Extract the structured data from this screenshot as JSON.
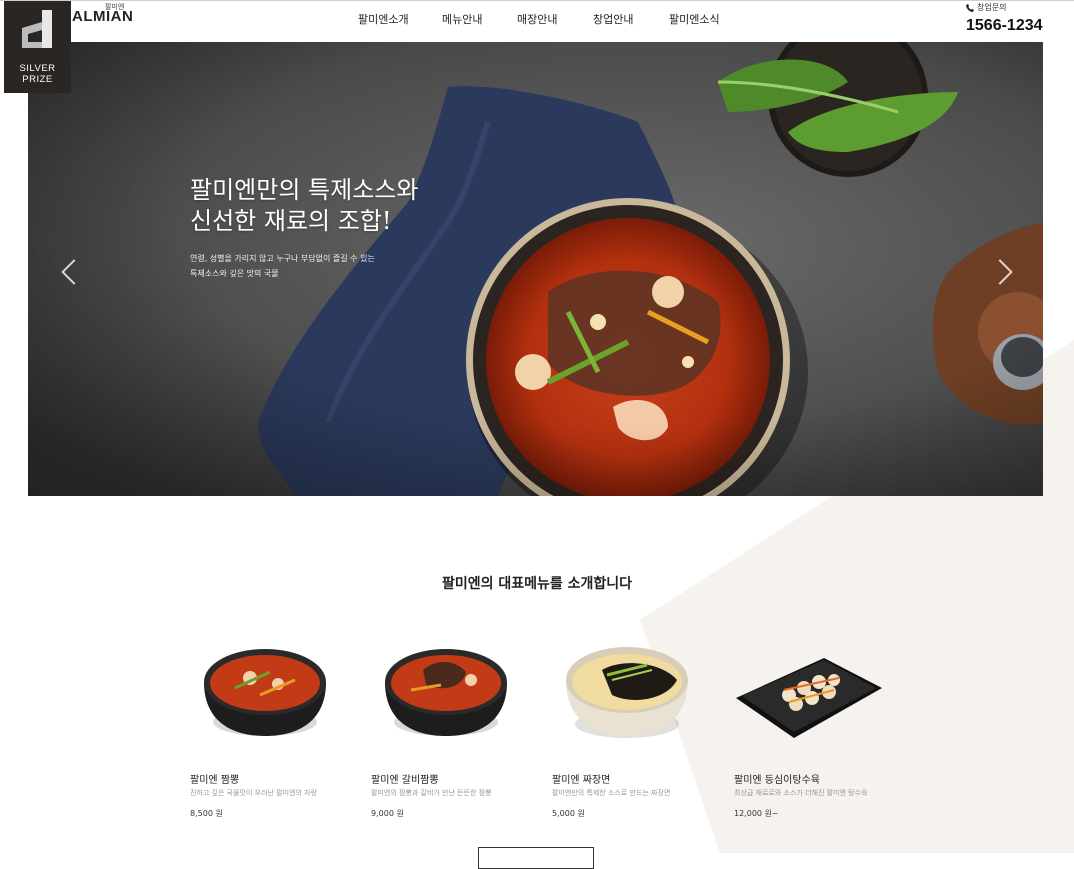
{
  "header": {
    "logo_small": "팔미엔",
    "logo": "ALMIAN",
    "nav": [
      "팔미엔소개",
      "메뉴안내",
      "매장안내",
      "창업안내",
      "팔미엔소식"
    ],
    "contact_label": "창업문의",
    "phone": "1566-1234"
  },
  "badge": {
    "line1": "SILVER",
    "line2": "PRIZE"
  },
  "hero": {
    "title": "팔미엔만의 특제소스와\n신선한 재료의 조합!",
    "subtitle": "연령, 성별을 가리지 않고 누구나 부담없이 즐길 수 있는\n특제소스와 깊은 맛의 국물"
  },
  "section": {
    "title": "팔미엔의 대표메뉴를 소개합니다",
    "menus": [
      {
        "name": "팔미엔 짬뽕",
        "desc": "진하고 깊은 국물맛이 우러난 팔미엔의 자랑",
        "price": "8,500 원",
        "icon": "jjamppong-bowl-icon"
      },
      {
        "name": "팔미엔 갈비짬뽕",
        "desc": "팔미엔의 짬뽕과 갈비가 만난 든든한 짬뽕",
        "price": "9,000 원",
        "icon": "galbi-jjamppong-bowl-icon"
      },
      {
        "name": "팔미엔 짜장면",
        "desc": "팔미엔만의 특제한 소스로 만드는 짜장면",
        "price": "5,000 원",
        "icon": "jajangmyeon-bowl-icon"
      },
      {
        "name": "팔미엔 등심이탕수육",
        "desc": "최상급 재료로와 소스가 더해진 팔미엔 탕수육",
        "price": "12,000 원~",
        "icon": "tangsuyuk-plate-icon"
      }
    ]
  }
}
